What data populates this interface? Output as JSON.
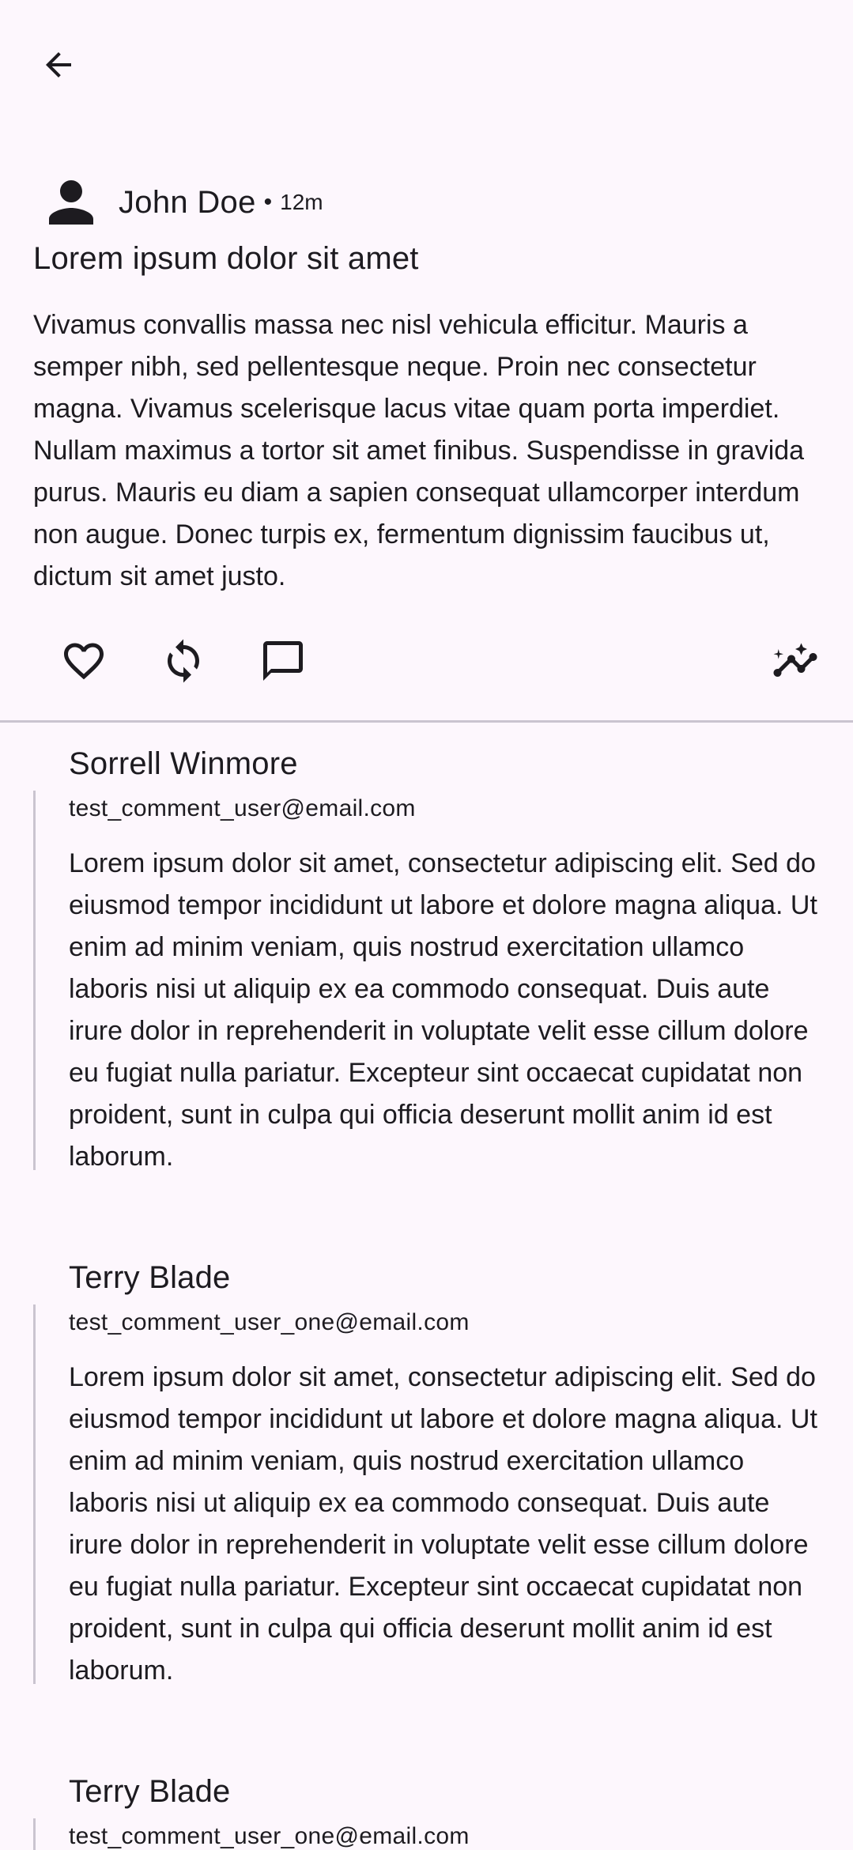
{
  "icons": {
    "back": "arrow-back-icon",
    "avatar": "person-icon",
    "like": "heart-outline-icon",
    "repost": "sync-icon",
    "comment": "chat-bubble-outline-icon",
    "insights": "insights-icon"
  },
  "colors": {
    "background": "#FDF7FD",
    "text": "#1D1B20",
    "divider": "#CAC4D0"
  },
  "post": {
    "author": "John Doe",
    "separator": "•",
    "time": "12m",
    "title": "Lorem ipsum dolor sit amet",
    "body": "Vivamus convallis massa nec nisl vehicula efficitur. Mauris a semper nibh, sed pellentesque neque. Proin nec consectetur magna. Vivamus scelerisque lacus vitae quam porta imperdiet. Nullam maximus a tortor sit amet finibus. Suspendisse in gravida purus. Mauris eu diam a sapien consequat ullamcorper interdum non augue. Donec turpis ex, fermentum dignissim faucibus ut, dictum sit amet justo."
  },
  "comments": [
    {
      "name": "Sorrell Winmore",
      "email": "test_comment_user@email.com",
      "text": "Lorem ipsum dolor sit amet, consectetur adipiscing elit. Sed do eiusmod tempor incididunt ut labore et dolore magna aliqua. Ut enim ad minim veniam, quis nostrud exercitation ullamco laboris nisi ut aliquip ex ea commodo consequat. Duis aute irure dolor in reprehenderit in voluptate velit esse cillum dolore eu fugiat nulla pariatur. Excepteur sint occaecat cupidatat non proident, sunt in culpa qui officia deserunt mollit anim id est laborum."
    },
    {
      "name": "Terry Blade",
      "email": "test_comment_user_one@email.com",
      "text": "Lorem ipsum dolor sit amet, consectetur adipiscing elit. Sed do eiusmod tempor incididunt ut labore et dolore magna aliqua. Ut enim ad minim veniam, quis nostrud exercitation ullamco laboris nisi ut aliquip ex ea commodo consequat. Duis aute irure dolor in reprehenderit in voluptate velit esse cillum dolore eu fugiat nulla pariatur. Excepteur sint occaecat cupidatat non proident, sunt in culpa qui officia deserunt mollit anim id est laborum."
    },
    {
      "name": "Terry Blade",
      "email": "test_comment_user_one@email.com"
    }
  ]
}
